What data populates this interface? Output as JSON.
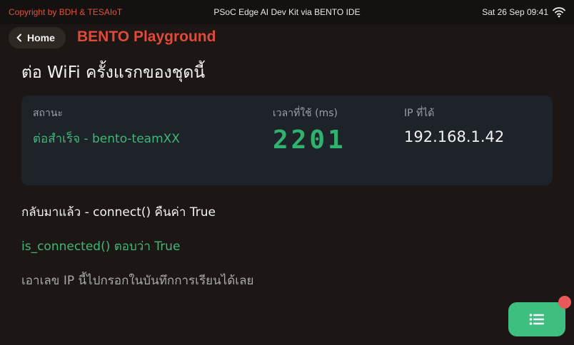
{
  "topbar": {
    "copyright": "Copyright by BDH & TESAIoT",
    "device": "PSoC Edge AI Dev Kit via BENTO IDE",
    "clock": "Sat 26 Sep 09:41",
    "wifi_icon": "wifi-icon"
  },
  "nav": {
    "home_label": "Home",
    "app_title": "BENTO Playground"
  },
  "page": {
    "heading": "ต่อ WiFi ครั้งแรกของชุดนี้"
  },
  "status_card": {
    "status_label": "สถานะ",
    "status_value": "ต่อสำเร็จ - bento-teamXX",
    "time_label": "เวลาที่ใช้ (ms)",
    "time_value": "2201",
    "ip_label": "IP ที่ได้",
    "ip_value": "192.168.1.42"
  },
  "messages": {
    "line1": "กลับมาแล้ว - connect() คืนค่า True",
    "line2": "is_connected() ตอบว่า True",
    "line3": "เอาเลข IP นี้ไปกรอกในบันทึกการเรียนได้เลย"
  },
  "colors": {
    "accent_red": "#e04a38",
    "success_green": "#3eb877",
    "fab_green": "#3fbf7f",
    "badge_red": "#e85a5a"
  }
}
